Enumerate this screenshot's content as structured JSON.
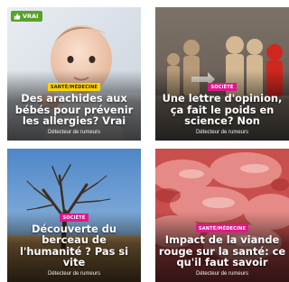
{
  "cards": [
    {
      "verdict_badge": {
        "label": "VRAI",
        "icon": "thumbs-up-icon",
        "color": "#5aa12b"
      },
      "category": "SANTÉ/MÉDECINE",
      "category_color": "#ffd400",
      "title": "Des arachides aux bébés pour prévenir les allergies? Vrai",
      "author": "Détecteur de rumeurs"
    },
    {
      "category": "SOCIÉTÉ",
      "category_color": "#e0178a",
      "title": "Une lettre d'opinion, ça fait le poids en science? Non",
      "author": "Détecteur de rumeurs"
    },
    {
      "category": "SOCIÉTÉ",
      "category_color": "#e0178a",
      "title": "Découverte du berceau de l'humanité ? Pas si vite",
      "author": "Détecteur de rumeurs"
    },
    {
      "category": "SANTÉ/MÉDECINE",
      "category_color": "#e0178a",
      "title": "Impact de la viande rouge sur la santé: ce qu'il faut savoir",
      "author": "Détecteur de rumeurs"
    }
  ]
}
